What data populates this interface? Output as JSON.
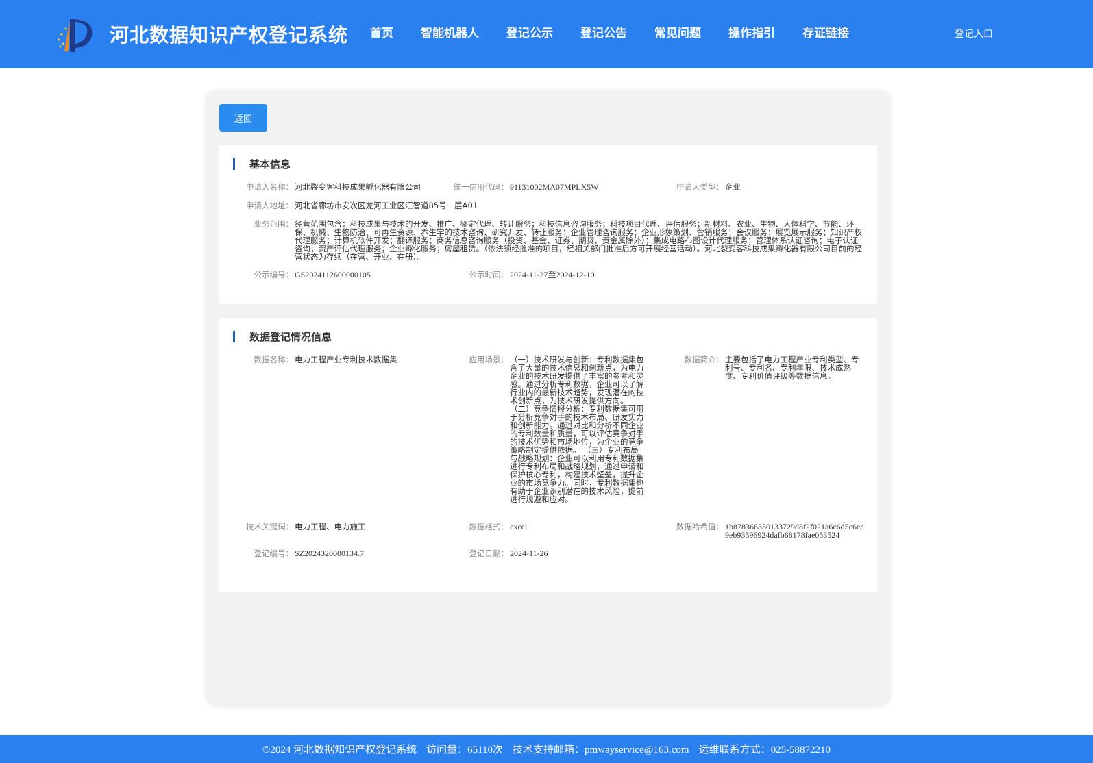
{
  "header": {
    "site_title": "河北数据知识产权登记系统",
    "nav": [
      "首页",
      "智能机器人",
      "登记公示",
      "登记公告",
      "常见问题",
      "操作指引",
      "存证链接"
    ],
    "login_label": "登记入口",
    "brand_color": "#2b80f0"
  },
  "back_label": "返回",
  "basic": {
    "title": "基本信息",
    "applicant_name_label": "申请人名称：",
    "applicant_name": "河北裂变客科技成果孵化器有限公司",
    "credit_code_label": "统一信用代码：",
    "credit_code": "91131002MA07MPLX5W",
    "applicant_type_label": "申请人类型：",
    "applicant_type": "企业",
    "address_label": "申请人地址：",
    "address": "河北省廊坊市安次区龙河工业区汇智道85号一层A01",
    "scope_label": "业务范围：",
    "scope": "经营范围包含：科技成果与技术的开发、推广、鉴定代理、转让服务；科技信息咨询服务；科技项目代理、评估服务；新材料、农业、生物、人体科学、节能、环保、机械、生物防治、可再生资源、养生学的技术咨询、研究开发、转让服务；企业管理咨询服务；企业形象策划、营销服务；会议服务；展览展示服务；知识产权代理服务；计算机软件开发；翻译服务；商务信息咨询服务（投资、基金、证券、期货、贵金属除外）；集成电路布图设计代理服务；管理体系认证咨询；电子认证咨询；资产评估代理服务；企业孵化服务；房屋租赁。（依法须经批准的项目，经相关部门批准后方可开展经营活动）。河北裂变客科技成果孵化器有限公司目前的经营状态为存续（在营、开业、在册）。",
    "notice_no_label": "公示编号：",
    "notice_no": "GS2024112600000105",
    "notice_time_label": "公示时间：",
    "notice_time": "2024-11-27至2024-12-10"
  },
  "data_reg": {
    "title": "数据登记情况信息",
    "name_label": "数据名称：",
    "name": "电力工程产业专利技术数据集",
    "scenario_label": "应用场景：",
    "scenario": "（一）技术研发与创新：专利数据集包含了大量的技术信息和创新点，为电力企业的技术研发提供了丰富的参考和灵感。通过分析专利数据，企业可以了解行业内的最新技术趋势，发现潜在的技术创新点，为技术研发提供方向。 （二）竞争情报分析：专利数据集可用于分析竞争对手的技术布局、研发实力和创新能力。通过对比和分析不同企业的专利数量和质量，可以评估竞争对手的技术优势和市场地位，为企业的竞争策略制定提供依据。 （三）专利布局与战略规划：企业可以利用专利数据集进行专利布局和战略规划，通过申请和保护核心专利，构建技术壁垒，提升企业的市场竞争力。同时，专利数据集也有助于企业识别潜在的技术风险，提前进行规避和应对。",
    "intro_label": "数据简介：",
    "intro": "主要包括了电力工程产业专利类型、专利号、专利名、专利年限、技术成熟度、专利价值评级等数据信息。",
    "keywords_label": "技术关键词：",
    "keywords": "电力工程、电力施工",
    "format_label": "数据格式：",
    "format": "excel",
    "hash_label": "数据哈希值：",
    "hash": "1b878366330133729d8f2f021a6c6d5c6ec9eb93596924dafb68178fae053524",
    "reg_no_label": "登记编号：",
    "reg_no": "SZ2024320000134.7",
    "reg_date_label": "登记日期：",
    "reg_date": "2024-11-26"
  },
  "footer": {
    "copyright": "©2024 河北数据知识产权登记系统",
    "visits": "访问量：65110次",
    "email": "技术支持邮箱：pmwayservice@163.com",
    "phone": "运维联系方式：025-58872210"
  }
}
